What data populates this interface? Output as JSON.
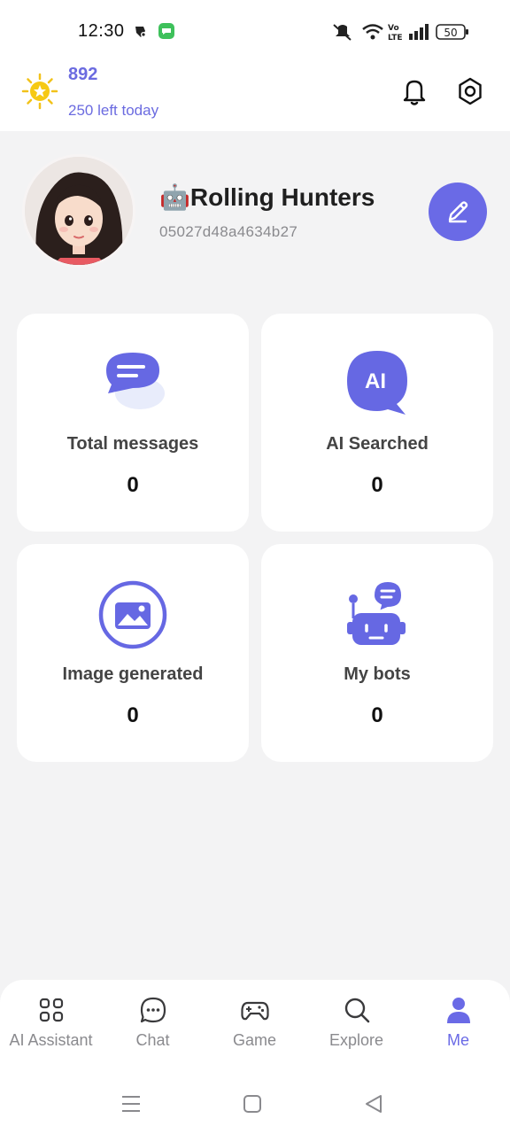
{
  "status_bar": {
    "time": "12:30",
    "battery": "50"
  },
  "header": {
    "points": "892",
    "points_sub": "250 left today"
  },
  "profile": {
    "name": "🤖Rolling Hunters",
    "user_id": "05027d48a4634b27"
  },
  "stats": [
    {
      "label": "Total messages",
      "value": "0",
      "icon": "chat-bubble-icon"
    },
    {
      "label": "AI Searched",
      "value": "0",
      "icon": "ai-bubble-icon"
    },
    {
      "label": "Image generated",
      "value": "0",
      "icon": "image-icon"
    },
    {
      "label": "My bots",
      "value": "0",
      "icon": "robot-icon"
    }
  ],
  "nav": {
    "items": [
      {
        "label": "AI Assistant",
        "icon": "grid-icon"
      },
      {
        "label": "Chat",
        "icon": "chat-icon"
      },
      {
        "label": "Game",
        "icon": "gamepad-icon"
      },
      {
        "label": "Explore",
        "icon": "search-icon"
      },
      {
        "label": "Me",
        "icon": "person-icon"
      }
    ],
    "active": "Me"
  },
  "colors": {
    "accent": "#6a6ae6",
    "background": "#f3f3f4",
    "card": "#ffffff"
  }
}
